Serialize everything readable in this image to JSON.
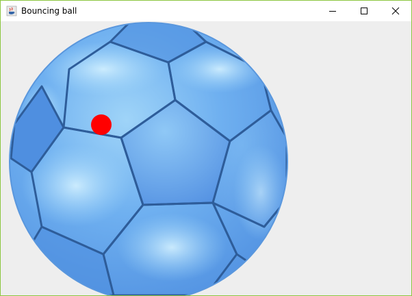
{
  "window": {
    "title": "Bouncing ball",
    "app_icon": "java-cup-icon",
    "controls": [
      "minimize-icon",
      "maximize-icon",
      "close-icon"
    ]
  },
  "canvas": {
    "background_color": "#eeeeee",
    "ball_image": "soccer-ball-icon",
    "ball_colors": [
      "#5b9bea",
      "#9fd4f8"
    ],
    "dot_color": "#ff0000"
  }
}
